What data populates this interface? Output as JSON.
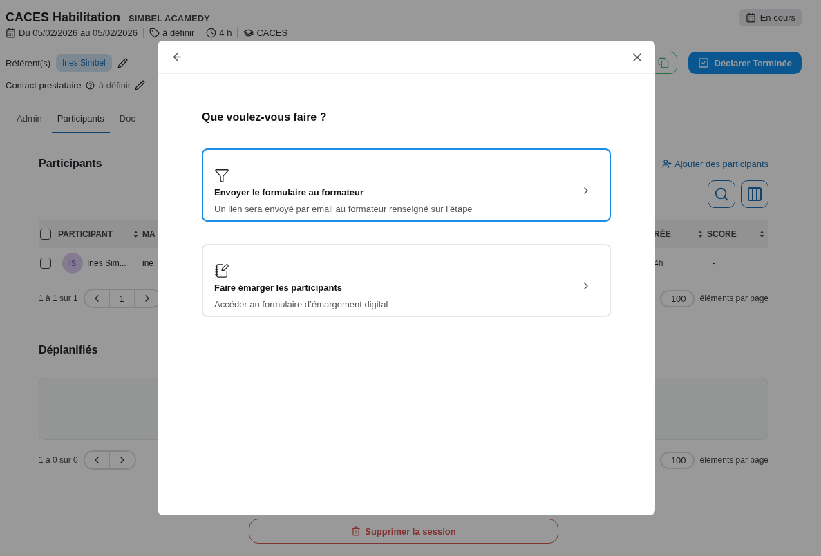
{
  "session": {
    "title": "CACES Habilitation",
    "organization": "SIMBEL ACAMEDY",
    "status": "En cours",
    "dates": "Du 05/02/2026 au 05/02/2026",
    "location": "à définir",
    "duration": "4 h",
    "category": "CACES",
    "referents_label": "Référent(s)",
    "referents": [
      "Ines Simbel"
    ],
    "contact_label": "Contact prestataire",
    "contact_value": "à définir"
  },
  "actions": {
    "finish_button": "Déclarer Terminée"
  },
  "tabs": [
    {
      "label": "Admin",
      "selected": false
    },
    {
      "label": "Participants",
      "selected": true
    },
    {
      "label": "Doc",
      "selected": false
    }
  ],
  "participants": {
    "title": "Participants",
    "add_link": "Ajouter des participants",
    "header_checked": false,
    "columns": [
      {
        "label": "PARTICIPANT"
      },
      {
        "label": "MA"
      },
      {
        "label": "RÉE"
      },
      {
        "label": "SCORE"
      }
    ],
    "rows": [
      {
        "checked": false,
        "initials": "IS",
        "name": "Ines Sim...",
        "column_2": "ine",
        "duration": "4h",
        "score": "-"
      }
    ],
    "pagination": {
      "range": "1 à 1 sur 1",
      "page": "1",
      "page_size": "100",
      "page_size_label": "éléments par page"
    }
  },
  "unscheduled": {
    "title": "Déplanifiés",
    "pagination": {
      "range": "1 à 0 sur 0",
      "page_size": "100",
      "page_size_label": "éléments par page"
    }
  },
  "delete_button": "Supprimer la session",
  "dialog": {
    "title": "Que voulez-vous faire ?",
    "options": [
      {
        "kind": "send",
        "title": "Envoyer le formulaire au formateur",
        "description": "Un lien sera envoyé par email au formateur renseigné sur l’étape",
        "selected": true
      },
      {
        "kind": "sign",
        "title": "Faire émarger les participants",
        "description": "Accéder au formulaire d’émargement digital",
        "selected": false
      }
    ]
  }
}
